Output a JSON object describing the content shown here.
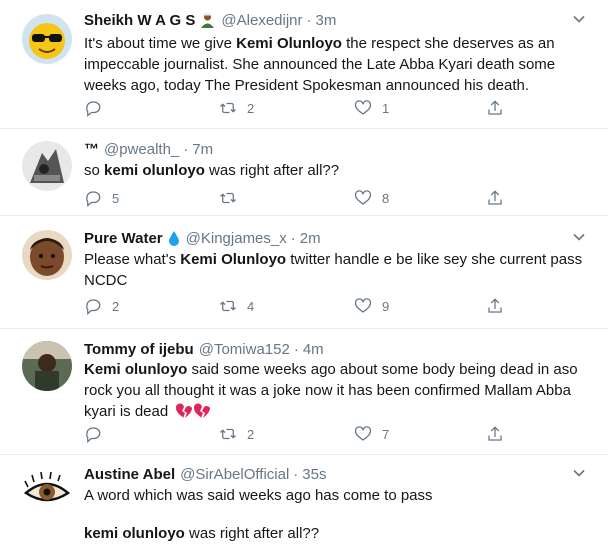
{
  "tweets": [
    {
      "name": "Sheikh W A G S",
      "handle": "@Alexedijnr",
      "time": "3m",
      "body_pre": "It's about time we give ",
      "body_bold": "Kemi Olunloyo",
      "body_post": " the respect she deserves as an impeccable journalist. She announced the Late Abba Kyari death some weeks ago, today The President Spokesman announced his death.",
      "replies": "",
      "retweets": "2",
      "likes": "1",
      "emoji_icon": "person-emoji-icon"
    },
    {
      "name": "™",
      "handle": "@pwealth_",
      "time": "7m",
      "body_pre": "so ",
      "body_bold": "kemi olunloyo",
      "body_post": " was right after all??",
      "replies": "5",
      "retweets": "",
      "likes": "8"
    },
    {
      "name": "Pure Water",
      "handle": "@Kingjames_x",
      "time": "2m",
      "body_pre": "Please what's ",
      "body_bold": "Kemi Olunloyo",
      "body_post": " twitter handle e be like sey she current pass NCDC",
      "replies": "2",
      "retweets": "4",
      "likes": "9",
      "emoji_icon": "droplet-emoji-icon"
    },
    {
      "name": "Tommy of ijebu",
      "handle": "@Tomiwa152",
      "time": "4m",
      "body_pre": "",
      "body_bold": "Kemi olunloyo",
      "body_post": " said some weeks ago about some body being dead in aso rock you all thought it was a joke now it has been confirmed Mallam Abba kyari is dead",
      "replies": "",
      "retweets": "2",
      "likes": "7",
      "emoji_icon": "broken-heart-emoji-icon"
    },
    {
      "name": "Austine Abel",
      "handle": "@SirAbelOfficial",
      "time": "35s",
      "body_line1": "A word which was said weeks ago has come to pass",
      "body_bold": "kemi olunloyo",
      "body_post": " was right after all??"
    }
  ],
  "separator": "·",
  "colors": {
    "text": "#14171a",
    "secondary": "#657786",
    "divider": "#e6ecf0",
    "broken_heart": "#e0245e",
    "verified_drop": "#1da1f2"
  }
}
